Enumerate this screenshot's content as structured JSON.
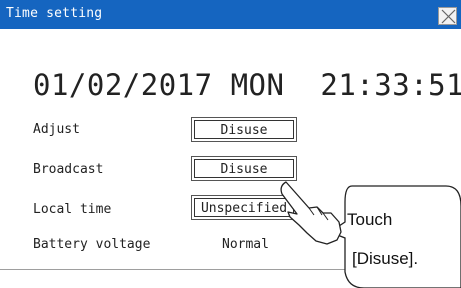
{
  "window": {
    "title": "Time setting",
    "close_icon": "close-x-icon"
  },
  "clock": {
    "date": "01/02/2017",
    "weekday": "MON",
    "time": "21:33:51"
  },
  "rows": {
    "adjust": {
      "label": "Adjust",
      "value": "Disuse"
    },
    "broadcast": {
      "label": "Broadcast",
      "value": "Disuse"
    },
    "local_time": {
      "label": "Local time",
      "value": "Unspecified"
    },
    "battery": {
      "label": "Battery voltage",
      "value": "Normal"
    }
  },
  "callout": {
    "line1": "Touch",
    "line2": "[Disuse].",
    "pointer_icon": "hand-pointer-icon"
  }
}
